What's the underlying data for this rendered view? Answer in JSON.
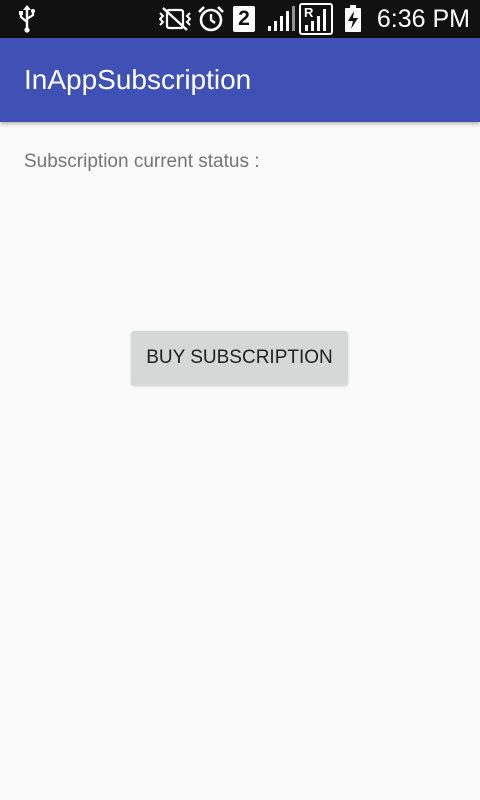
{
  "status_bar": {
    "time": "6:36 PM",
    "notification_count": "2",
    "icons": [
      "usb-icon",
      "vibrate-icon",
      "alarm-icon",
      "notification-badge-icon",
      "signal-icon",
      "roaming-signal-icon",
      "battery-charging-icon"
    ]
  },
  "app_bar": {
    "title": "InAppSubscription",
    "color": "#3f51b5"
  },
  "main": {
    "status_label": "Subscription current status :",
    "buy_button_label": "BUY SUBSCRIPTION"
  }
}
